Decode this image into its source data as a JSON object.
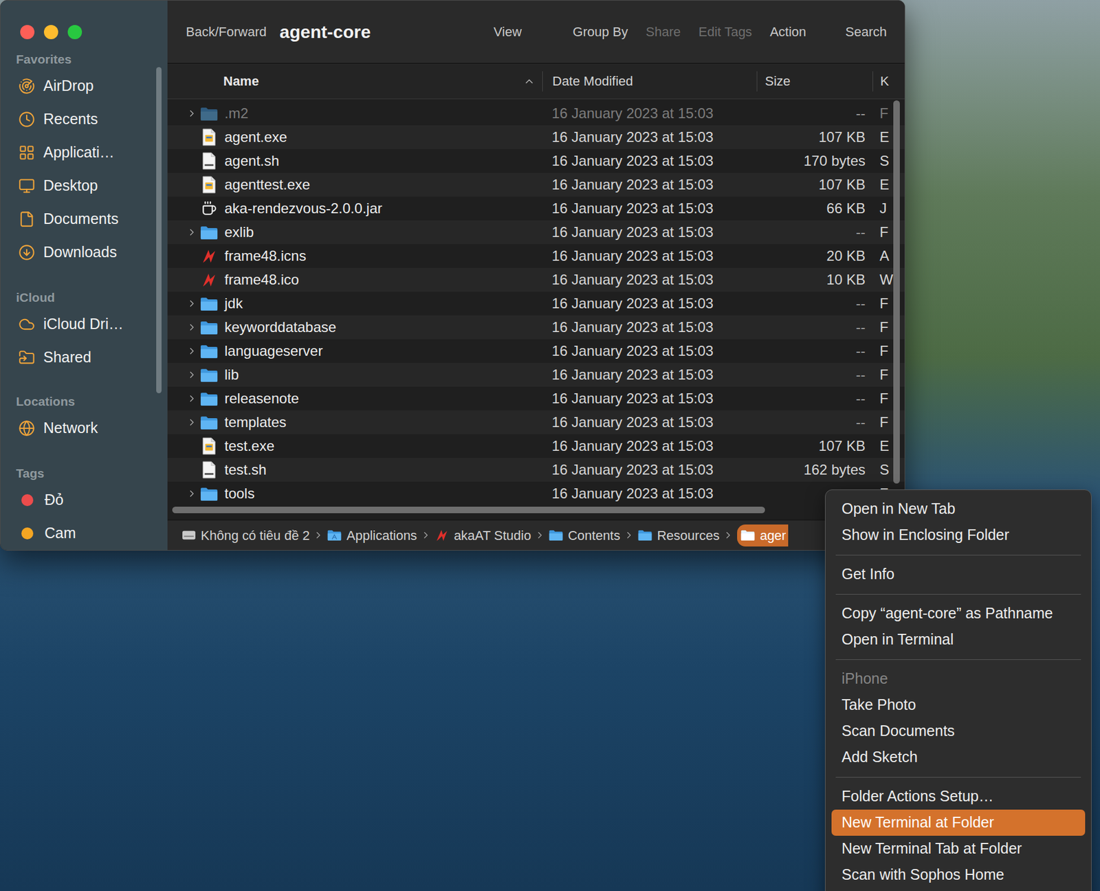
{
  "window": {
    "title": "agent-core"
  },
  "toolbar": {
    "nav": {
      "label": "Back/Forward"
    },
    "items": [
      {
        "label": "View",
        "disabled": false
      },
      {
        "label": "Group By",
        "disabled": false
      },
      {
        "label": "Share",
        "disabled": true
      },
      {
        "label": "Edit Tags",
        "disabled": true
      },
      {
        "label": "Action",
        "disabled": false
      },
      {
        "label": "Search",
        "disabled": false
      }
    ]
  },
  "sidebar": {
    "sections": [
      {
        "title": "Favorites",
        "items": [
          {
            "label": "AirDrop"
          },
          {
            "label": "Recents"
          },
          {
            "label": "Applicati…"
          },
          {
            "label": "Desktop"
          },
          {
            "label": "Documents"
          },
          {
            "label": "Downloads"
          }
        ]
      },
      {
        "title": "iCloud",
        "items": [
          {
            "label": "iCloud Dri…"
          },
          {
            "label": "Shared"
          }
        ]
      },
      {
        "title": "Locations",
        "items": [
          {
            "label": "Network"
          }
        ]
      },
      {
        "title": "Tags",
        "items": [
          {
            "label": "Đỏ",
            "color": "#ec4c4c"
          },
          {
            "label": "Cam",
            "color": "#f5a623"
          }
        ]
      }
    ]
  },
  "table": {
    "columns": [
      {
        "label": "Name",
        "sorted": true,
        "ascending": true
      },
      {
        "label": "Date Modified",
        "sorted": false,
        "ascending": true
      },
      {
        "label": "Size",
        "sorted": false,
        "ascending": true
      },
      {
        "label": "K",
        "sorted": false,
        "ascending": true
      }
    ],
    "rows": [
      {
        "name": ".m2",
        "date": "16 January 2023 at 15:03",
        "size": "--",
        "type": "F",
        "kind": "folder",
        "expanded": false,
        "dimmed": true
      },
      {
        "name": "agent.exe",
        "date": "16 January 2023 at 15:03",
        "size": "107 KB",
        "type": "E",
        "kind": "exe",
        "expanded": false,
        "dimmed": false
      },
      {
        "name": "agent.sh",
        "date": "16 January 2023 at 15:03",
        "size": "170 bytes",
        "type": "S",
        "kind": "shell",
        "expanded": false,
        "dimmed": false
      },
      {
        "name": "agenttest.exe",
        "date": "16 January 2023 at 15:03",
        "size": "107 KB",
        "type": "E",
        "kind": "exe",
        "expanded": false,
        "dimmed": false
      },
      {
        "name": "aka-rendezvous-2.0.0.jar",
        "date": "16 January 2023 at 15:03",
        "size": "66 KB",
        "type": "J",
        "kind": "jar",
        "expanded": false,
        "dimmed": false
      },
      {
        "name": "exlib",
        "date": "16 January 2023 at 15:03",
        "size": "--",
        "type": "F",
        "kind": "folder",
        "expanded": false,
        "dimmed": false
      },
      {
        "name": "frame48.icns",
        "date": "16 January 2023 at 15:03",
        "size": "20 KB",
        "type": "A",
        "kind": "logo",
        "expanded": false,
        "dimmed": false
      },
      {
        "name": "frame48.ico",
        "date": "16 January 2023 at 15:03",
        "size": "10 KB",
        "type": "W",
        "kind": "logo",
        "expanded": false,
        "dimmed": false
      },
      {
        "name": "jdk",
        "date": "16 January 2023 at 15:03",
        "size": "--",
        "type": "F",
        "kind": "folder",
        "expanded": false,
        "dimmed": false
      },
      {
        "name": "keyworddatabase",
        "date": "16 January 2023 at 15:03",
        "size": "--",
        "type": "F",
        "kind": "folder",
        "expanded": false,
        "dimmed": false
      },
      {
        "name": "languageserver",
        "date": "16 January 2023 at 15:03",
        "size": "--",
        "type": "F",
        "kind": "folder",
        "expanded": false,
        "dimmed": false
      },
      {
        "name": "lib",
        "date": "16 January 2023 at 15:03",
        "size": "--",
        "type": "F",
        "kind": "folder",
        "expanded": false,
        "dimmed": false
      },
      {
        "name": "releasenote",
        "date": "16 January 2023 at 15:03",
        "size": "--",
        "type": "F",
        "kind": "folder",
        "expanded": false,
        "dimmed": false
      },
      {
        "name": "templates",
        "date": "16 January 2023 at 15:03",
        "size": "--",
        "type": "F",
        "kind": "folder",
        "expanded": false,
        "dimmed": false
      },
      {
        "name": "test.exe",
        "date": "16 January 2023 at 15:03",
        "size": "107 KB",
        "type": "E",
        "kind": "exe",
        "expanded": false,
        "dimmed": false
      },
      {
        "name": "test.sh",
        "date": "16 January 2023 at 15:03",
        "size": "162 bytes",
        "type": "S",
        "kind": "shell",
        "expanded": false,
        "dimmed": false
      },
      {
        "name": "tools",
        "date": "16 January 2023 at 15:03",
        "size": "--",
        "type": "F",
        "kind": "folder",
        "expanded": false,
        "dimmed": false
      }
    ]
  },
  "path_bar": [
    {
      "label": "Không có tiêu đề 2",
      "kind": "disk",
      "selected": false
    },
    {
      "label": "Applications",
      "kind": "applications",
      "selected": false
    },
    {
      "label": "akaAT Studio",
      "kind": "app",
      "selected": false
    },
    {
      "label": "Contents",
      "kind": "folder",
      "selected": false
    },
    {
      "label": "Resources",
      "kind": "folder",
      "selected": false
    },
    {
      "label": "ager",
      "kind": "folder",
      "selected": true
    }
  ],
  "context_menu": {
    "sections": [
      [
        {
          "label": "Open in New Tab",
          "disabled": false,
          "selected": false
        },
        {
          "label": "Show in Enclosing Folder",
          "disabled": false,
          "selected": false
        }
      ],
      [
        {
          "label": "Get Info",
          "disabled": false,
          "selected": false
        }
      ],
      [
        {
          "label": "Copy “agent-core” as Pathname",
          "disabled": false,
          "selected": false
        },
        {
          "label": "Open in Terminal",
          "disabled": false,
          "selected": false
        }
      ],
      [
        {
          "label": "iPhone",
          "disabled": true,
          "selected": false
        },
        {
          "label": "Take Photo",
          "disabled": false,
          "selected": false
        },
        {
          "label": "Scan Documents",
          "disabled": false,
          "selected": false
        },
        {
          "label": "Add Sketch",
          "disabled": false,
          "selected": false
        }
      ],
      [
        {
          "label": "Folder Actions Setup…",
          "disabled": false,
          "selected": false
        },
        {
          "label": "New Terminal at Folder",
          "disabled": false,
          "selected": true
        },
        {
          "label": "New Terminal Tab at Folder",
          "disabled": false,
          "selected": false
        },
        {
          "label": "Scan with Sophos Home",
          "disabled": false,
          "selected": false
        }
      ]
    ]
  }
}
